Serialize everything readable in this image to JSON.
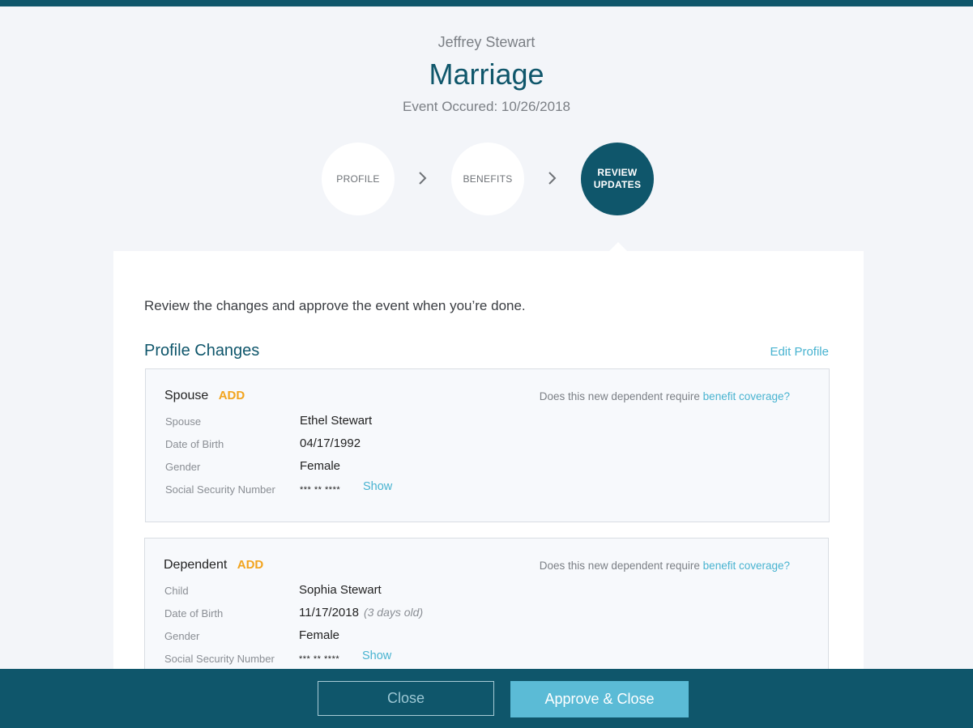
{
  "header": {
    "person_name": "Jeffrey Stewart",
    "event_title": "Marriage",
    "event_date": "Event Occured: 10/26/2018"
  },
  "steps": [
    {
      "label": "PROFILE",
      "active": false
    },
    {
      "label": "BENEFITS",
      "active": false
    },
    {
      "label_line1": "REVIEW",
      "label_line2": "UPDATES",
      "active": true
    }
  ],
  "review": {
    "intro": "Review the changes and approve the event when you’re done.",
    "section_title": "Profile Changes",
    "edit_link": "Edit Profile"
  },
  "cards": [
    {
      "type": "Spouse",
      "badge": "ADD",
      "question_prefix": "Does this new dependent require ",
      "question_link": "benefit coverage?",
      "rows": [
        {
          "label": "Spouse",
          "value": "Ethel Stewart"
        },
        {
          "label": "Date of Birth",
          "value": "04/17/1992"
        },
        {
          "label": "Gender",
          "value": "Female"
        },
        {
          "label": "Social Security Number",
          "value": "*** ** ****",
          "action": "Show"
        }
      ]
    },
    {
      "type": "Dependent",
      "badge": "ADD",
      "question_prefix": "Does this new dependent require ",
      "question_link": "benefit coverage?",
      "rows": [
        {
          "label": "Child",
          "value": "Sophia Stewart"
        },
        {
          "label": "Date of Birth",
          "value": "11/17/2018",
          "note": "(3 days old)"
        },
        {
          "label": "Gender",
          "value": "Female"
        },
        {
          "label": "Social Security Number",
          "value": "*** ** ****",
          "action": "Show"
        }
      ]
    }
  ],
  "footer": {
    "close_label": "Close",
    "approve_label": "Approve & Close"
  },
  "colors": {
    "brand": "#0f566b",
    "accent_link": "#48b3d0",
    "badge": "#f2a41e",
    "approve_button": "#5bbbd6"
  },
  "icons": {
    "step_separator": "chevron-right-icon"
  }
}
